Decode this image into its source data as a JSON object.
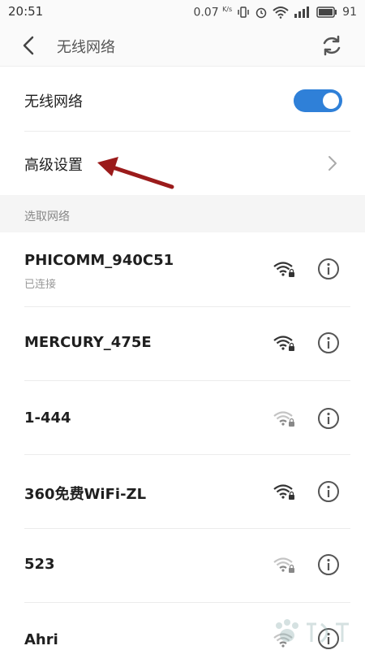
{
  "status_bar": {
    "time": "20:51",
    "speed": "0.07",
    "speed_unit": "K/s",
    "battery": "91"
  },
  "app_bar": {
    "title": "无线网络",
    "back_icon": "back-arrow-icon",
    "refresh_icon": "refresh-icon"
  },
  "wifi_toggle": {
    "label": "无线网络",
    "enabled": true,
    "color": "#2f80d8"
  },
  "advanced": {
    "label": "高级设置"
  },
  "section": {
    "label": "选取网络"
  },
  "networks": [
    {
      "name": "PHICOMM_940C51",
      "status": "已连接",
      "signal": "strong",
      "locked": true
    },
    {
      "name": "MERCURY_475E",
      "status": "",
      "signal": "strong",
      "locked": true
    },
    {
      "name": "1-444",
      "status": "",
      "signal": "weak",
      "locked": true
    },
    {
      "name": "360免费WiFi-ZL",
      "status": "",
      "signal": "strong",
      "locked": true
    },
    {
      "name": "523",
      "status": "",
      "signal": "weak",
      "locked": true
    },
    {
      "name": "Ahri",
      "status": "",
      "signal": "weak",
      "locked": true
    }
  ],
  "annotation": {
    "arrow_color": "#9b1b1b"
  }
}
